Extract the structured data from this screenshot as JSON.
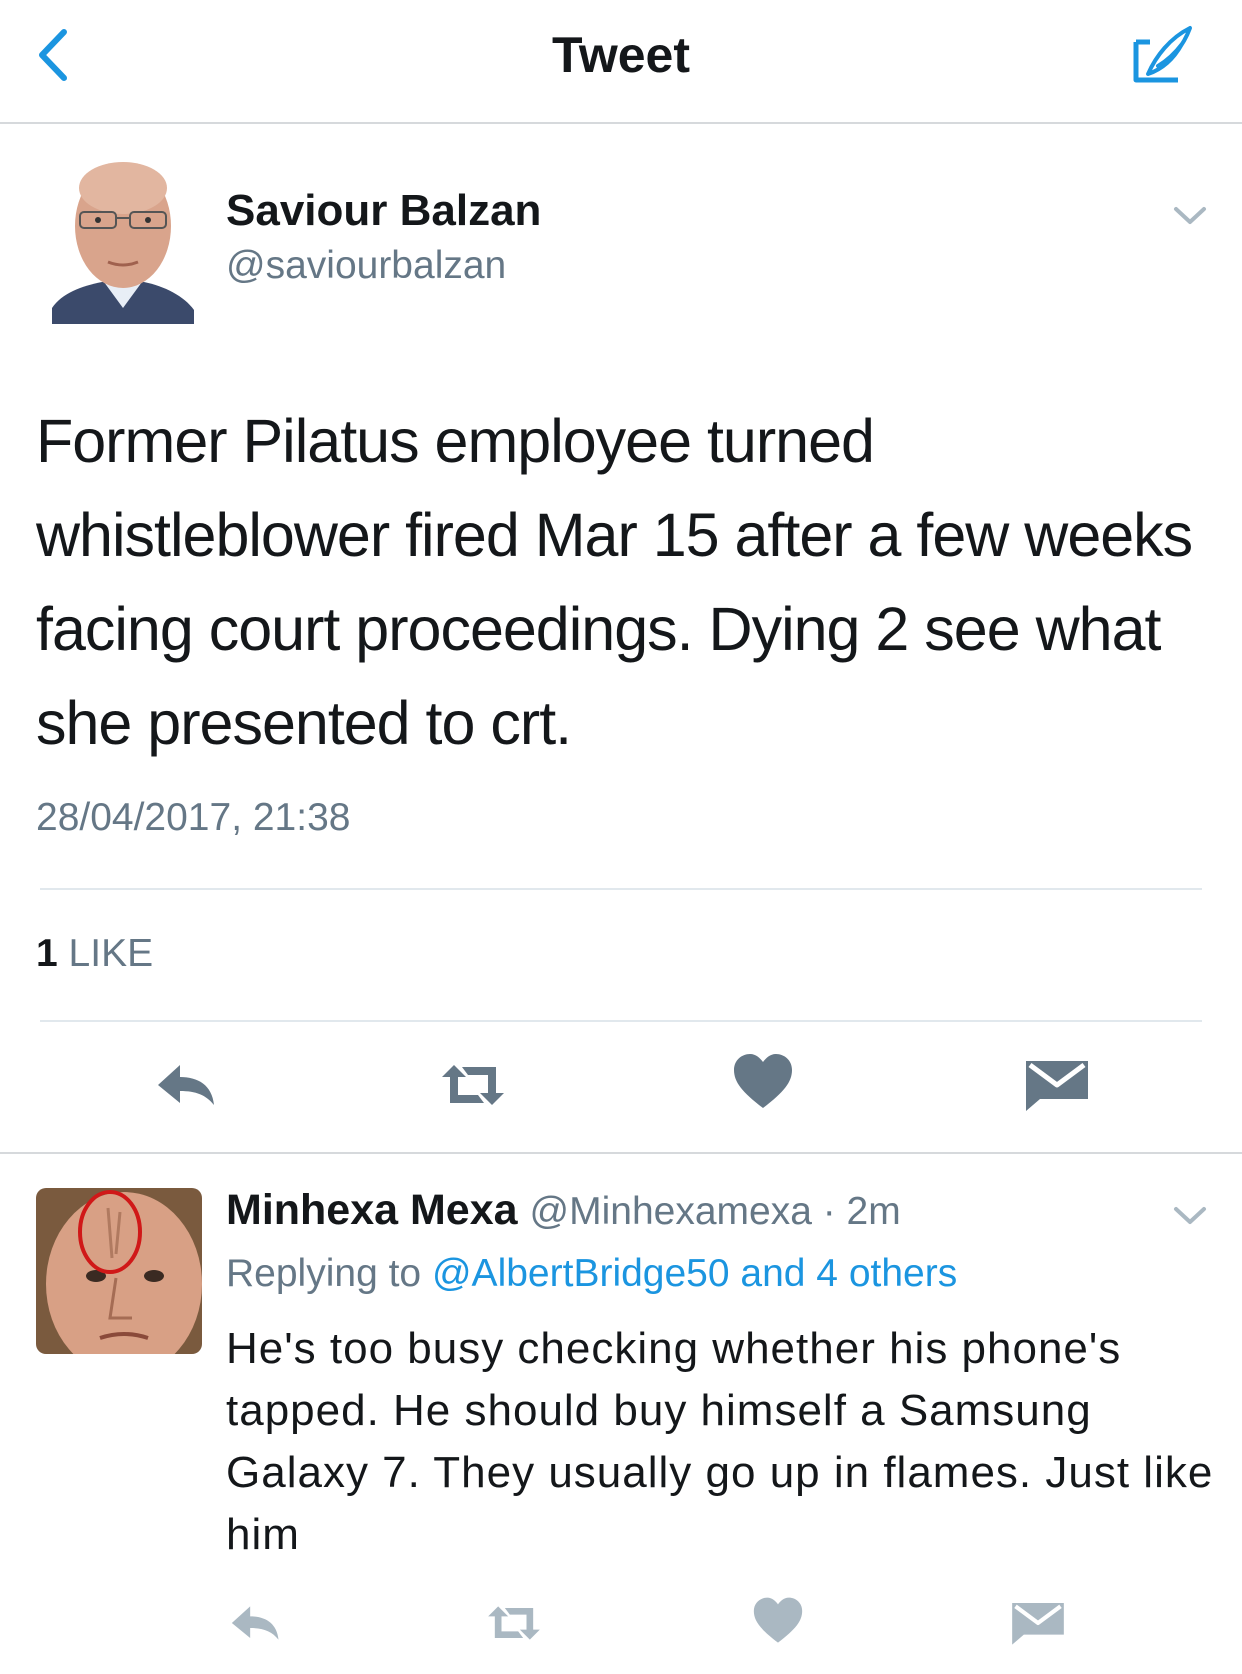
{
  "nav": {
    "title": "Tweet",
    "back_icon": "chevron-left-icon",
    "compose_icon": "compose-icon",
    "accent_color": "#1b95e0"
  },
  "main_tweet": {
    "author_name": "Saviour Balzan",
    "author_handle": "@saviourbalzan",
    "text": "Former Pilatus employee turned whistleblower fired Mar 15 after a few weeks facing court proceedings. Dying 2 see what she presented to crt.",
    "timestamp": "28/04/2017, 21:38",
    "likes_count": "1",
    "likes_label": "LIKE",
    "actions": [
      "reply-icon",
      "retweet-icon",
      "like-icon",
      "direct-message-icon"
    ]
  },
  "reply_tweet": {
    "author_name": "Minhexa Mexa",
    "meta": "@Minhexamexa · 2m",
    "replying_prefix": "Replying to",
    "replying_targets": "@AlbertBridge50 and 4 others",
    "text": "He's too busy checking whether his phone's tapped. He should buy himself a Samsung Galaxy 7. They usually go up in flames. Just like him",
    "actions": [
      "reply-icon",
      "retweet-icon",
      "like-icon",
      "direct-message-icon"
    ]
  }
}
